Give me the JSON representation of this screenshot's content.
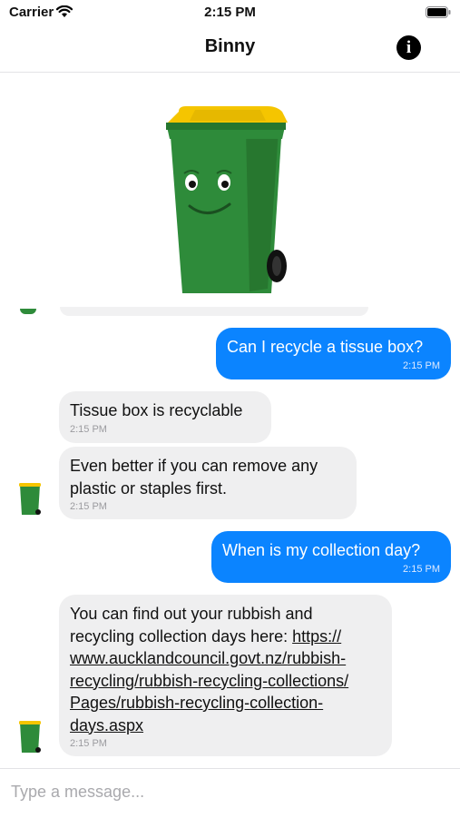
{
  "status_bar": {
    "carrier": "Carrier",
    "time": "2:15 PM"
  },
  "nav": {
    "title": "Binny",
    "info_glyph": "i"
  },
  "icons": {
    "status": [
      "wifi-icon",
      "battery-icon"
    ],
    "nav": "info-icon",
    "avatar": "wheelie-bin-avatar"
  },
  "colors": {
    "outgoing_bubble": "#0b84ff",
    "incoming_bubble": "#efeff0",
    "bin_green": "#2e8b3a",
    "bin_lid": "#f5c500"
  },
  "messages": [
    {
      "direction": "outgoing",
      "text": "Can I recycle a tissue box?",
      "time": "2:15 PM"
    },
    {
      "direction": "incoming",
      "text": "Tissue box is recyclable",
      "time": "2:15 PM"
    },
    {
      "direction": "incoming",
      "text": "Even better if you can remove any plastic or staples first.",
      "time": "2:15 PM"
    },
    {
      "direction": "outgoing",
      "text": "When is my collection day?",
      "time": "2:15 PM"
    },
    {
      "direction": "incoming",
      "text_before_link": "You can find out your rubbish and recycling collection days here: ",
      "link": "https://www.aucklandcouncil.govt.nz/rubbish-recycling/rubbish-recycling-collections/Pages/rubbish-recycling-collection-days.aspx",
      "time": "2:15 PM"
    }
  ],
  "composer": {
    "placeholder": "Type a message..."
  }
}
